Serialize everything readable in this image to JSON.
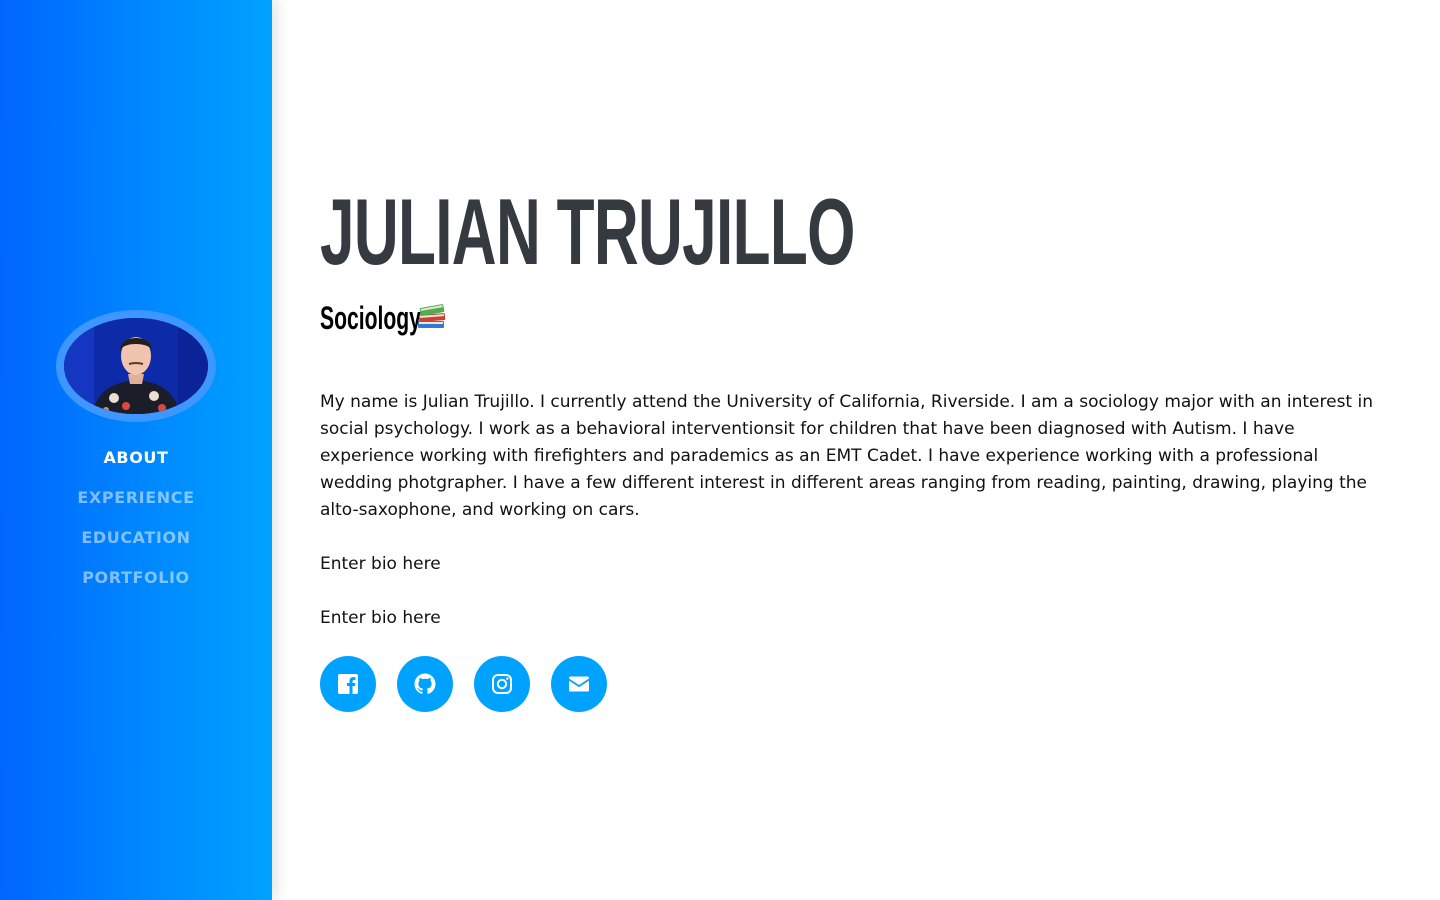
{
  "sidebar": {
    "avatar_alt": "profile photo",
    "nav": [
      {
        "label": "About",
        "active": true
      },
      {
        "label": "Experience",
        "active": false
      },
      {
        "label": "Education",
        "active": false
      },
      {
        "label": "Portfolio",
        "active": false
      }
    ]
  },
  "main": {
    "name": "Julian Trujillo",
    "subtitle": "Sociology",
    "subtitle_icon": "books-icon",
    "bio": [
      "My name is Julian Trujillo. I currently attend the University of California, Riverside. I am a sociology major with an interest in social psychology. I work as a behavioral interventionsit for children that have been diagnosed with Autism. I have experience working with firefighters and parademics as an EMT Cadet. I have experience working with a professional wedding photgrapher. I have a few different interest in different areas ranging from reading, painting, drawing, playing the alto-saxophone, and working on cars.",
      "Enter bio here",
      "Enter bio here"
    ],
    "socials": [
      "facebook-icon",
      "github-icon",
      "instagram-icon",
      "envelope-icon"
    ]
  },
  "colors": {
    "sidebar_gradient_start": "#0066ff",
    "sidebar_gradient_end": "#00a2ff",
    "social_button": "#00a2ff",
    "name_text": "#343a40"
  }
}
